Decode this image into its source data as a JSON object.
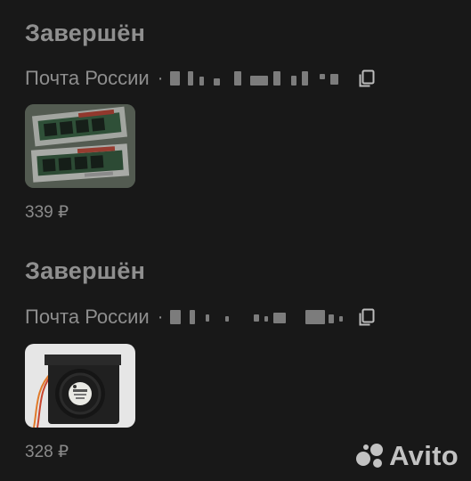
{
  "orders": [
    {
      "status": "Завершён",
      "carrier": "Почта России",
      "separator": "·",
      "price": "339 ₽",
      "image_alt": "ram-modules-photo"
    },
    {
      "status": "Завершён",
      "carrier": "Почта России",
      "separator": "·",
      "price": "328 ₽",
      "image_alt": "cooling-fan-photo"
    }
  ],
  "watermark": {
    "brand": "Avito"
  },
  "icons": {
    "copy": "copy-icon",
    "logo": "avito-logo-icon"
  },
  "colors": {
    "background": "#181818",
    "text": "#8f8f8f"
  }
}
